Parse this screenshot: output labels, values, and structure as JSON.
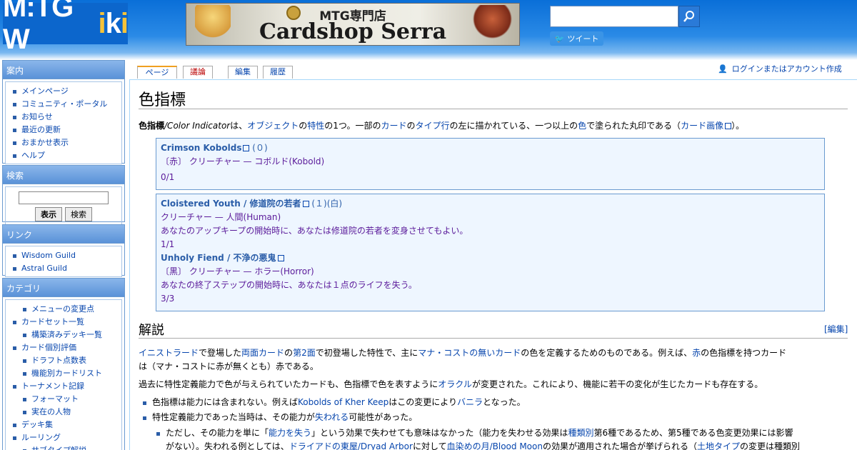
{
  "header": {
    "logo": "M:TG Wiki",
    "banner_title": "MTG専門店",
    "banner_sub": "Cardshop Serra",
    "tweet": "ツイート"
  },
  "sidebar": {
    "nav_title": "案内",
    "nav": [
      "メインページ",
      "コミュニティ・ポータル",
      "お知らせ",
      "最近の更新",
      "おまかせ表示",
      "ヘルプ"
    ],
    "search_title": "検索",
    "search_go": "表示",
    "search_btn": "検索",
    "links_title": "リンク",
    "links": [
      "Wisdom Guild",
      "Astral Guild"
    ],
    "cat_title": "カテゴリ",
    "cats": [
      {
        "t": "メニューの変更点",
        "sub": true
      },
      {
        "t": "カードセット一覧",
        "sub": false
      },
      {
        "t": "構築済みデッキ一覧",
        "sub": true
      },
      {
        "t": "カード個別評価",
        "sub": false
      },
      {
        "t": "ドラフト点数表",
        "sub": true
      },
      {
        "t": "機能別カードリスト",
        "sub": true
      },
      {
        "t": "トーナメント記録",
        "sub": false
      },
      {
        "t": "フォーマット",
        "sub": true
      },
      {
        "t": "実在の人物",
        "sub": true
      },
      {
        "t": "デッキ集",
        "sub": false
      },
      {
        "t": "ルーリング",
        "sub": false
      },
      {
        "t": "サブタイプ解説",
        "sub": true
      }
    ]
  },
  "tabs": {
    "page": "ページ",
    "talk": "議論",
    "edit": "編集",
    "history": "履歴"
  },
  "user_link": "ログインまたはアカウント作成",
  "page": {
    "title": "色指標",
    "intro": [
      "色指標",
      "/Color Indicator",
      "は、",
      "オブジェクト",
      "の",
      "特性",
      "の1つ。一部の",
      "カード",
      "の",
      "タイプ行",
      "の左に描かれている、一つ以上の",
      "色",
      "で塗られた丸印である（",
      "カード画像",
      "）。"
    ],
    "card1": {
      "name": "Crimson Kobolds",
      "cost": " (０)",
      "type": "〔赤〕 クリーチャー — コボルド(Kobold)",
      "pt": "0/1"
    },
    "card2": {
      "name": "Cloistered Youth / 修道院の若者",
      "cost": " (１)(白)",
      "type": "クリーチャー — 人間(Human)",
      "text": "あなたのアップキープの開始時に、あなたは修道院の若者を変身させてもよい。",
      "pt": "1/1",
      "back_name": "Unholy Fiend / 不浄の悪鬼",
      "back_type": "〔黒〕 クリーチャー — ホラー(Horror)",
      "back_text": "あなたの終了ステップの開始時に、あなたは１点のライフを失う。",
      "back_pt": "3/3"
    },
    "section": "解説",
    "edit_label": "[編集]",
    "para1a": [
      "イニストラード",
      "で登場した",
      "両面カード",
      "の",
      "第2面",
      "で初登場した特性で、主に",
      "マナ・コストの無いカード",
      "の色を定義するためのものである。例えば、",
      "赤",
      "の色指標を持つカード"
    ],
    "para1b": "は（マナ・コストに赤が無くとも）赤である。",
    "para2": [
      "過去に特性定義能力で色が与えられていたカードも、色指標で色を表すように",
      "オラクル",
      "が変更された。これにより、機能に若干の変化が生じたカードも存在する。"
    ],
    "bullet1": [
      "色指標は能力には含まれない。例えば",
      "Kobolds of Kher Keep",
      "はこの変更により",
      "バニラ",
      "となった。"
    ],
    "bullet2": [
      "特性定義能力であった当時は、その能力が",
      "失われる",
      "可能性があった。"
    ],
    "bullet3a": [
      "ただし、その能力を単に「",
      "能力を失う",
      "」という効果で失わせても意味はなかった（能力を失わせる効果は",
      "種類別",
      "第6種であるため、第5種である色変更効果には影響"
    ],
    "bullet3b": [
      "がない）。失われる例としては、",
      "ドライアドの東屋/Dryad Arbor",
      "に対して",
      "血染めの月/Blood Moon",
      "の効果が適用された場合が挙げられる（",
      "土地タイプ",
      "の変更は種類別"
    ]
  }
}
